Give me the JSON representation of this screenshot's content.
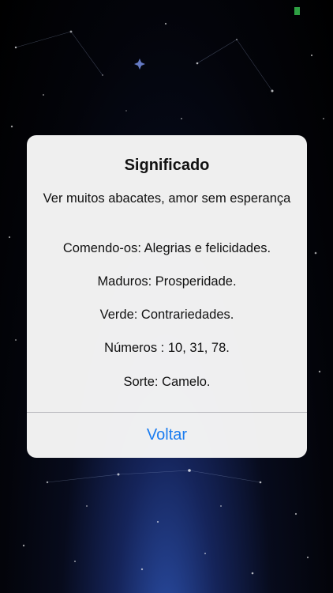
{
  "alert": {
    "title": "Significado",
    "lines": [
      "Ver muitos abacates, amor sem esperança",
      "Comendo-os: Alegrias e felicidades.",
      "Maduros: Prosperidade.",
      "Verde: Contrariedades.",
      "Números : 10, 31, 78.",
      "Sorte: Camelo."
    ],
    "button_label": "Voltar"
  },
  "colors": {
    "accent": "#1a7cf0",
    "status_indicator": "#2ea043"
  }
}
